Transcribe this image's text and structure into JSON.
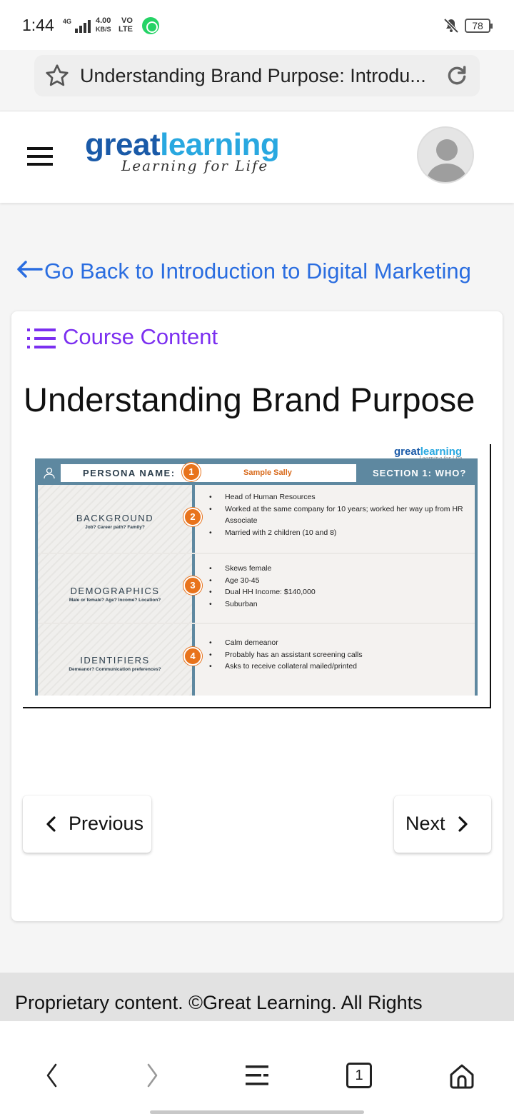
{
  "status_bar": {
    "time": "1:44",
    "network_small": "4G",
    "data_rate": "4.00",
    "data_rate_unit": "KB/S",
    "volte_top": "VO",
    "volte_bottom": "LTE",
    "battery": "78",
    "icons": [
      "signal-icon",
      "whatsapp-icon",
      "mute-icon",
      "battery-icon"
    ]
  },
  "browser": {
    "url_title": "Understanding Brand Purpose: Introdu...",
    "icons": [
      "star-icon",
      "reload-icon"
    ]
  },
  "header": {
    "logo_great": "great",
    "logo_learning": "learning",
    "logo_tagline": "Learning for Life",
    "brand_colors": {
      "great": "#1a5aa8",
      "learning": "#29a8e0"
    }
  },
  "back_link": {
    "text": "Go Back to Introduction to Digital Marketing"
  },
  "course_content": {
    "label": "Course Content",
    "color": "#7b2ff0"
  },
  "page_title": "Understanding Brand Purpose",
  "slide": {
    "logo_great": "great",
    "logo_learning": "learning",
    "logo_tagline": "Learning for Life",
    "persona_label": "PERSONA NAME:",
    "persona_value": "Sample Sally",
    "section": "SECTION 1: WHO?",
    "badges": [
      "1",
      "2",
      "3",
      "4"
    ],
    "categories": [
      {
        "title": "BACKGROUND",
        "subtitle": "Job? Career path? Family?",
        "bullets": [
          "Head of Human Resources",
          "Worked at the same company for 10 years; worked her way up from HR Associate",
          "Married with 2 children (10 and 8)"
        ]
      },
      {
        "title": "DEMOGRAPHICS",
        "subtitle": "Male or female? Age? Income? Location?",
        "bullets": [
          "Skews female",
          "Age 30-45",
          "Dual HH Income: $140,000",
          "Suburban"
        ]
      },
      {
        "title": "IDENTIFIERS",
        "subtitle": "Demeanor? Communication preferences?",
        "bullets": [
          "Calm demeanor",
          "Probably has an assistant screening calls",
          "Asks to receive collateral mailed/printed"
        ]
      }
    ]
  },
  "pagination": {
    "previous": "Previous",
    "next": "Next"
  },
  "footer": {
    "text": "Proprietary content. ©Great Learning. All Rights Reserved. Unauthorized use or distribution prohibited."
  },
  "bottom_nav": {
    "tab_count": "1"
  }
}
